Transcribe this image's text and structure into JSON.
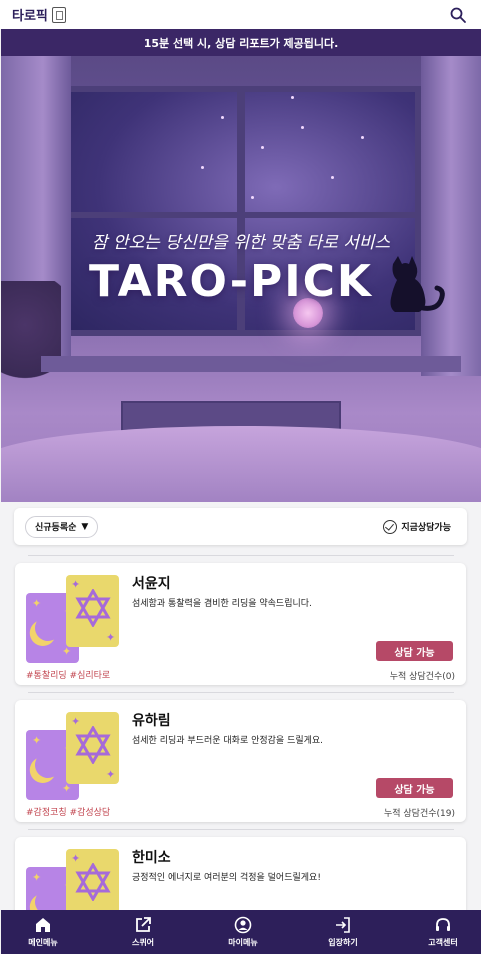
{
  "header": {
    "brand": "타로픽",
    "brand_icon": "tarot-card-icon",
    "search_icon": "search-icon"
  },
  "notice": {
    "text": "15분 선택 시, 상담 리포트가 제공됩니다."
  },
  "hero": {
    "subtitle": "잠 안오는 당신만을 위한 맞춤 타로 서비스",
    "title": "TARO-PICK",
    "icon": "black-cat-icon"
  },
  "filters": {
    "sort_label": "신규등록순",
    "sort_icon": "caret-down-icon",
    "available_label": "지금상담가능",
    "available_icon": "check-circle-icon"
  },
  "readers": [
    {
      "name": "서윤지",
      "description": "섬세함과 통찰력을 겸비한 리딩을 약속드립니다.",
      "tags": "#통찰리딩 #심리타로",
      "status": "상담 가능",
      "count": "누적 상담건수(0)"
    },
    {
      "name": "유하림",
      "description": "섬세한 리딩과 부드러운 대화로 안정감을 드릴게요.",
      "tags": "#감정코칭 #감성상담",
      "status": "상담 가능",
      "count": "누적 상담건수(19)"
    },
    {
      "name": "한미소",
      "description": "긍정적인 에너지로 여러분의 걱정을 덜어드릴게요!"
    }
  ],
  "nav": [
    {
      "label": "메인메뉴",
      "icon": "home-icon"
    },
    {
      "label": "스퀴어",
      "icon": "share-icon"
    },
    {
      "label": "마이메뉴",
      "icon": "user-circle-icon"
    },
    {
      "label": "입장하기",
      "icon": "login-icon"
    },
    {
      "label": "고객센터",
      "icon": "headset-icon"
    }
  ],
  "colors": {
    "primary_dark": "#2d1f5a",
    "notice_bg": "#3b2766",
    "status_button": "#b64967",
    "tag_text": "#c2454f",
    "card_purple": "#b784e6",
    "card_yellow": "#e9d86c"
  }
}
